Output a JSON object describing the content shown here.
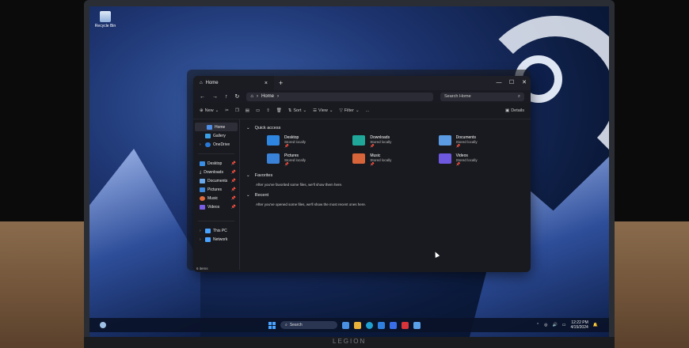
{
  "desktop": {
    "recycle_bin_label": "Recycle Bin"
  },
  "window": {
    "tab_title": "Home",
    "search_placeholder": "Search Home",
    "breadcrumb": [
      "Home"
    ],
    "toolbar": {
      "new": "New",
      "sort": "Sort",
      "view": "View",
      "filter": "Filter",
      "more": "...",
      "details": "Details"
    },
    "nav": {
      "top": [
        {
          "label": "Home",
          "color": "#4f8ee6"
        },
        {
          "label": "Gallery",
          "color": "#3aa0e6"
        },
        {
          "label": "OneDrive",
          "color": "#2a78d6"
        }
      ],
      "pinned": [
        {
          "label": "Desktop",
          "color": "#3a8ee6"
        },
        {
          "label": "Downloads",
          "color": "#2bb3a8"
        },
        {
          "label": "Documents",
          "color": "#6aa7e8"
        },
        {
          "label": "Pictures",
          "color": "#3c88de"
        },
        {
          "label": "Music",
          "color": "#e06a3a"
        },
        {
          "label": "Videos",
          "color": "#7a5de6"
        }
      ],
      "bottom": [
        {
          "label": "This PC",
          "color": "#4aa3ff"
        },
        {
          "label": "Network",
          "color": "#4aa3ff"
        }
      ]
    },
    "sections": {
      "quick_access": "Quick access",
      "favorites": "Favorites",
      "favorites_hint": "After you've favorited some files, we'll show them here.",
      "recent": "Recent",
      "recent_hint": "After you've opened some files, we'll show the most recent ones here."
    },
    "quick_access": [
      {
        "name": "Desktop",
        "sub": "Stored locally",
        "color": "#2f86e0"
      },
      {
        "name": "Downloads",
        "sub": "Stored locally",
        "color": "#1fa89a"
      },
      {
        "name": "Documents",
        "sub": "Stored locally",
        "color": "#5b9be3"
      },
      {
        "name": "Pictures",
        "sub": "Stored locally",
        "color": "#3a82d8"
      },
      {
        "name": "Music",
        "sub": "Stored locally",
        "color": "#d8643a"
      },
      {
        "name": "Videos",
        "sub": "Stored locally",
        "color": "#6e58e0"
      }
    ],
    "status": "6 items"
  },
  "taskbar": {
    "search_label": "Search",
    "time": "12:22 PM",
    "date": "4/15/2024",
    "app_colors": [
      "#4a90e2",
      "#e8b23a",
      "#1fa0d0",
      "#2f7fe0",
      "#3a6ee8",
      "#d8343a",
      "#5aa0e8"
    ]
  },
  "brand": "LEGION"
}
